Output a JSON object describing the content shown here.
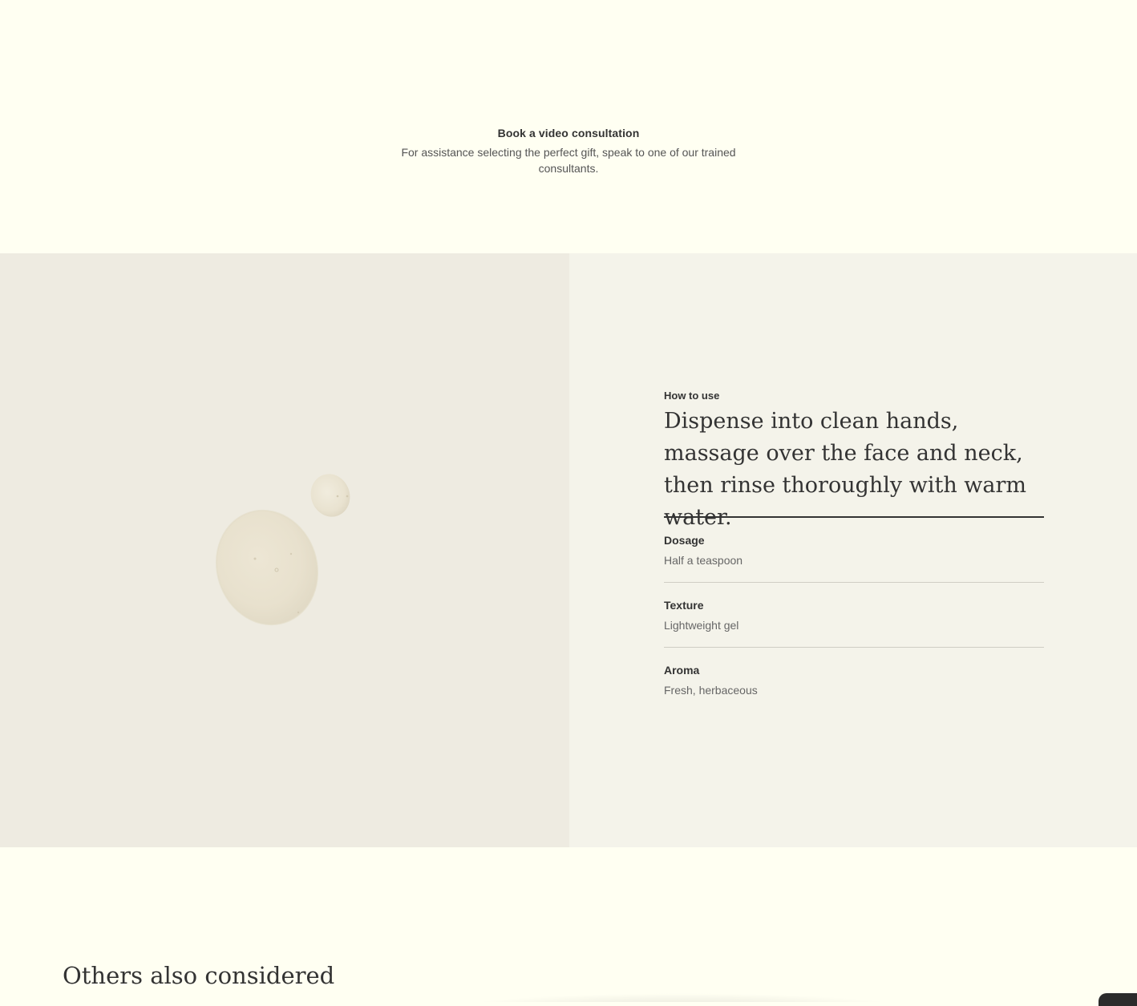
{
  "consultation": {
    "title": "Book a video consultation",
    "description": "For assistance selecting the perfect gift, speak to one of our trained consultants."
  },
  "how_to_use": {
    "eyebrow": "How to use",
    "headline": "Dispense into clean hands, massage over the face and neck, then rinse thoroughly with warm water.",
    "attributes": [
      {
        "label": "Dosage",
        "value": "Half a teaspoon"
      },
      {
        "label": "Texture",
        "value": "Lightweight gel"
      },
      {
        "label": "Aroma",
        "value": "Fresh, herbaceous"
      }
    ]
  },
  "others": {
    "title": "Others also considered"
  },
  "colors": {
    "page_background": "#fffff2",
    "image_background": "#eeebe1",
    "panel_background": "#f4f3ea",
    "text_primary": "#333333",
    "text_secondary": "#666666"
  }
}
